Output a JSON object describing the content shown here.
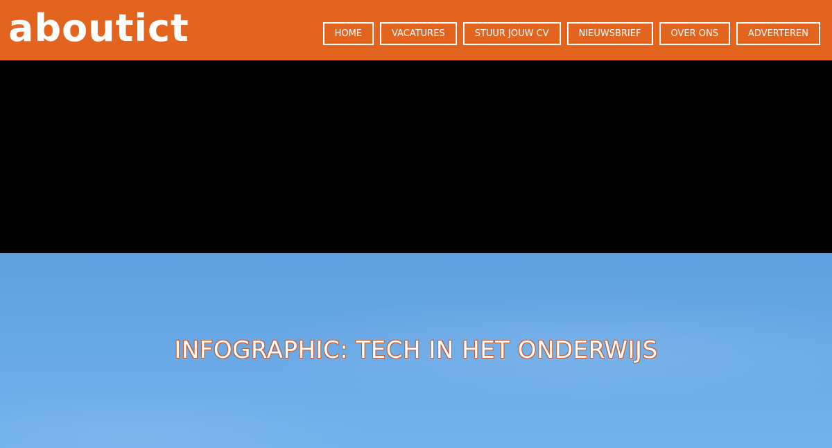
{
  "header": {
    "logo_text": "aboutict",
    "background_color": "#e3641f",
    "nav": [
      {
        "label": "HOME"
      },
      {
        "label": "VACATURES"
      },
      {
        "label": "STUUR JOUW CV"
      },
      {
        "label": "NIEUWSBRIEF"
      },
      {
        "label": "OVER ONS"
      },
      {
        "label": "ADVERTEREN"
      }
    ]
  },
  "hero": {
    "title": "INFOGRAPHIC: TECH IN HET ONDERWIJS",
    "sky_color": "#68a8e6"
  }
}
